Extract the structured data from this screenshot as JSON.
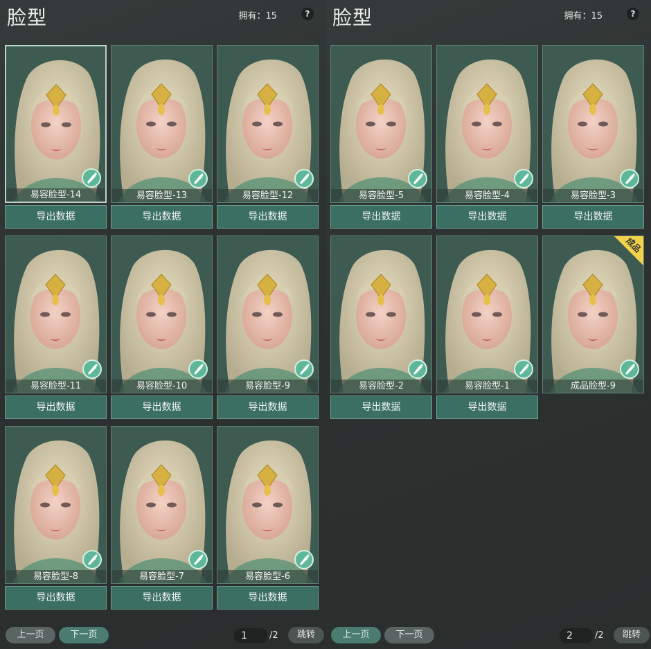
{
  "left": {
    "title": "脸型",
    "owned_label": "拥有：15",
    "help": "?",
    "cards": [
      {
        "name": "易容脸型-14",
        "export": "导出数据",
        "selected": true
      },
      {
        "name": "易容脸型-13",
        "export": "导出数据"
      },
      {
        "name": "易容脸型-12",
        "export": "导出数据"
      },
      {
        "name": "易容脸型-11",
        "export": "导出数据"
      },
      {
        "name": "易容脸型-10",
        "export": "导出数据"
      },
      {
        "name": "易容脸型-9",
        "export": "导出数据"
      },
      {
        "name": "易容脸型-8",
        "export": "导出数据"
      },
      {
        "name": "易容脸型-7",
        "export": "导出数据"
      },
      {
        "name": "易容脸型-6",
        "export": "导出数据"
      }
    ],
    "pager": {
      "prev": "上一页",
      "next": "下一页",
      "page": "1",
      "total": "/2",
      "jump": "跳转"
    }
  },
  "right": {
    "title": "脸型",
    "owned_label": "拥有：15",
    "help": "?",
    "cards": [
      {
        "name": "易容脸型-5",
        "export": "导出数据"
      },
      {
        "name": "易容脸型-4",
        "export": "导出数据"
      },
      {
        "name": "易容脸型-3",
        "export": "导出数据"
      },
      {
        "name": "易容脸型-2",
        "export": "导出数据"
      },
      {
        "name": "易容脸型-1",
        "export": "导出数据"
      },
      {
        "name": "成品脸型-9",
        "tag": "成品"
      }
    ],
    "pager": {
      "prev": "上一页",
      "next": "下一页",
      "page": "2",
      "total": "/2",
      "jump": "跳转"
    }
  }
}
